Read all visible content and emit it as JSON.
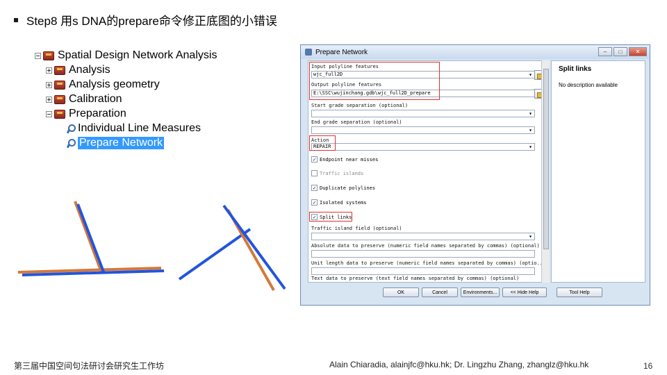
{
  "slide": {
    "title": "Step8 用s DNA的prepare命令修正底图的小错误"
  },
  "tree": {
    "root": "Spatial Design Network Analysis",
    "items": [
      "Analysis",
      "Analysis geometry",
      "Calibration",
      "Preparation"
    ],
    "tools": [
      "Individual Line Measures",
      "Prepare Network"
    ]
  },
  "dialog": {
    "title": "Prepare Network",
    "fields": {
      "input_label": "Input polyline features",
      "input_value": "wjc_full2D",
      "output_label": "Output polyline features",
      "output_value": "E:\\SSC\\wujinchang.gdb\\wjc_full2D_prepare",
      "start_grade_label": "Start grade separation (optional)",
      "end_grade_label": "End grade separation (optional)",
      "action_label": "Action",
      "action_value": "REPAIR",
      "traffic_island_field_label": "Traffic island field (optional)",
      "absolute_label": "Absolute data to preserve (numeric field names separated by commas) (optional)",
      "unit_length_label": "Unit length data to preserve (numeric field names separated by commas) (optio...",
      "text_label": "Text data to preserve (text field names separated by commas) (optional)"
    },
    "checkboxes": [
      {
        "label": "Endpoint near misses",
        "checked": true
      },
      {
        "label": "Traffic islands",
        "checked": false
      },
      {
        "label": "Duplicate polylines",
        "checked": true
      },
      {
        "label": "Isolated systems",
        "checked": true
      },
      {
        "label": "Split links",
        "checked": true
      }
    ],
    "help_title": "Split links",
    "help_text": "No description available",
    "buttons": {
      "ok": "OK",
      "cancel": "Cancel",
      "environments": "Environments...",
      "hide_help": "<< Hide Help",
      "tool_help": "Tool Help"
    },
    "window_buttons": {
      "minimize": "–",
      "maximize": "□",
      "close": "✕"
    }
  },
  "footer": {
    "left": "第三届中国空间句法研讨会研究生工作坊",
    "right": "Alain Chiaradia, alainjfc@hku.hk; Dr. Lingzhu Zhang, zhanglz@hku.hk",
    "page": "16"
  },
  "colors": {
    "blue_line": "#2255dd",
    "orange_line": "#d4783a",
    "highlight": "#e03030",
    "selection": "#3399ff"
  }
}
